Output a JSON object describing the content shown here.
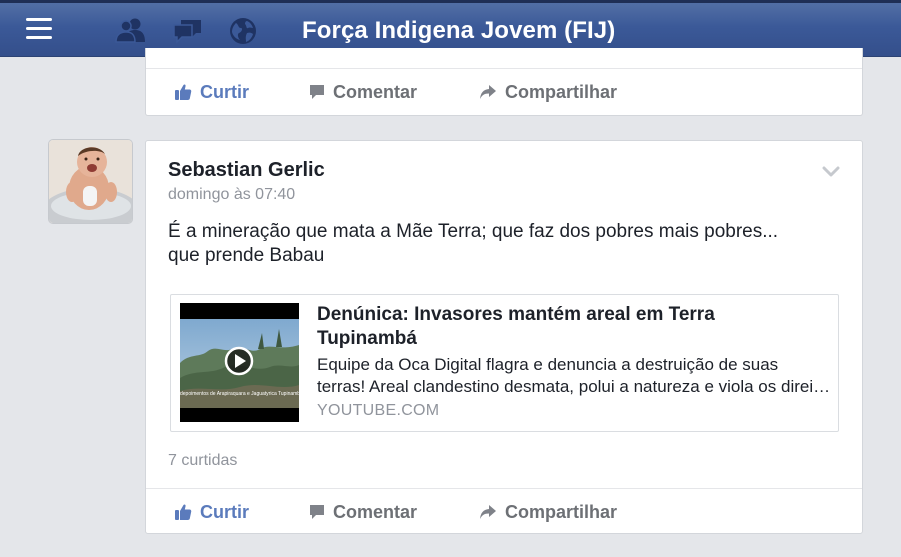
{
  "header": {
    "title": "Força Indigena Jovem (FIJ)",
    "icons": [
      "menu-icon",
      "friends-icon",
      "messages-icon",
      "notifications-globe-icon"
    ]
  },
  "prev_post": {
    "actions": {
      "like": "Curtir",
      "comment": "Comentar",
      "share": "Compartilhar"
    }
  },
  "post": {
    "author": "Sebastian Gerlic",
    "timestamp": "domingo às 07:40",
    "text_line1": "É a mineração que mata a Mãe Terra; que faz dos pobres mais pobres...",
    "text_line2": "que prende Babau",
    "link": {
      "title": "Denúnica: Invasores mantém areal em Terra Tupinambá",
      "description_line1": "Equipe da Oca Digital flagra e denuncia a destruição de suas",
      "description_line2": "terras! Areal clandestino desmata, polui a natureza e viola os direitos",
      "domain": "YOUTUBE.COM",
      "thumbnail_caption": "depoimentos de Arapiraquara e Jaguatyrica Tupinambá"
    },
    "likes": "7 curtidas",
    "actions": {
      "like": "Curtir",
      "comment": "Comentar",
      "share": "Compartilhar"
    }
  },
  "colors": {
    "header_blue": "#3b5998",
    "like_blue": "#5b7bbc",
    "muted_gray": "#90949c",
    "background": "#e4e6ea"
  }
}
